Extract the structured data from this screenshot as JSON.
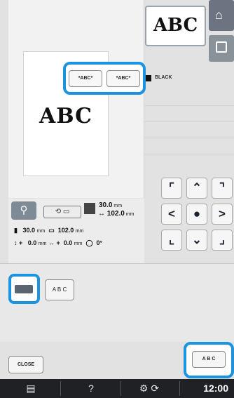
{
  "preview": {
    "text": "ABC"
  },
  "thumbnail": {
    "text": "ABC"
  },
  "colors": {
    "label": "BLACK",
    "accent": "#1a94e0",
    "thread": "#111111"
  },
  "nav": {
    "home_icon": "home-icon",
    "frame_icon": "frame-icon"
  },
  "arrows": {
    "up_left": "⌜",
    "up": "⌃",
    "up_right": "⌝",
    "left": "<",
    "center": "●",
    "right": ">",
    "down_left": "⌞",
    "down": "⌄",
    "down_right": "⌟"
  },
  "info": {
    "size_top": "30.0",
    "size_bottom": "102.0",
    "width_label": "30.0",
    "width_unit": "mm",
    "height_label": "102.0",
    "height_unit": "mm",
    "offset_x": "0.0",
    "offset_y": "0.0",
    "offset_unit": "mm",
    "angle": "0°"
  },
  "font_panel": {
    "tab_text_label": "A B C",
    "option_a": "*ABC*",
    "option_b": "*ABC*"
  },
  "buttons": {
    "close": "CLOSE",
    "abc": "A B C"
  },
  "taskbar": {
    "clock": "12:00"
  }
}
